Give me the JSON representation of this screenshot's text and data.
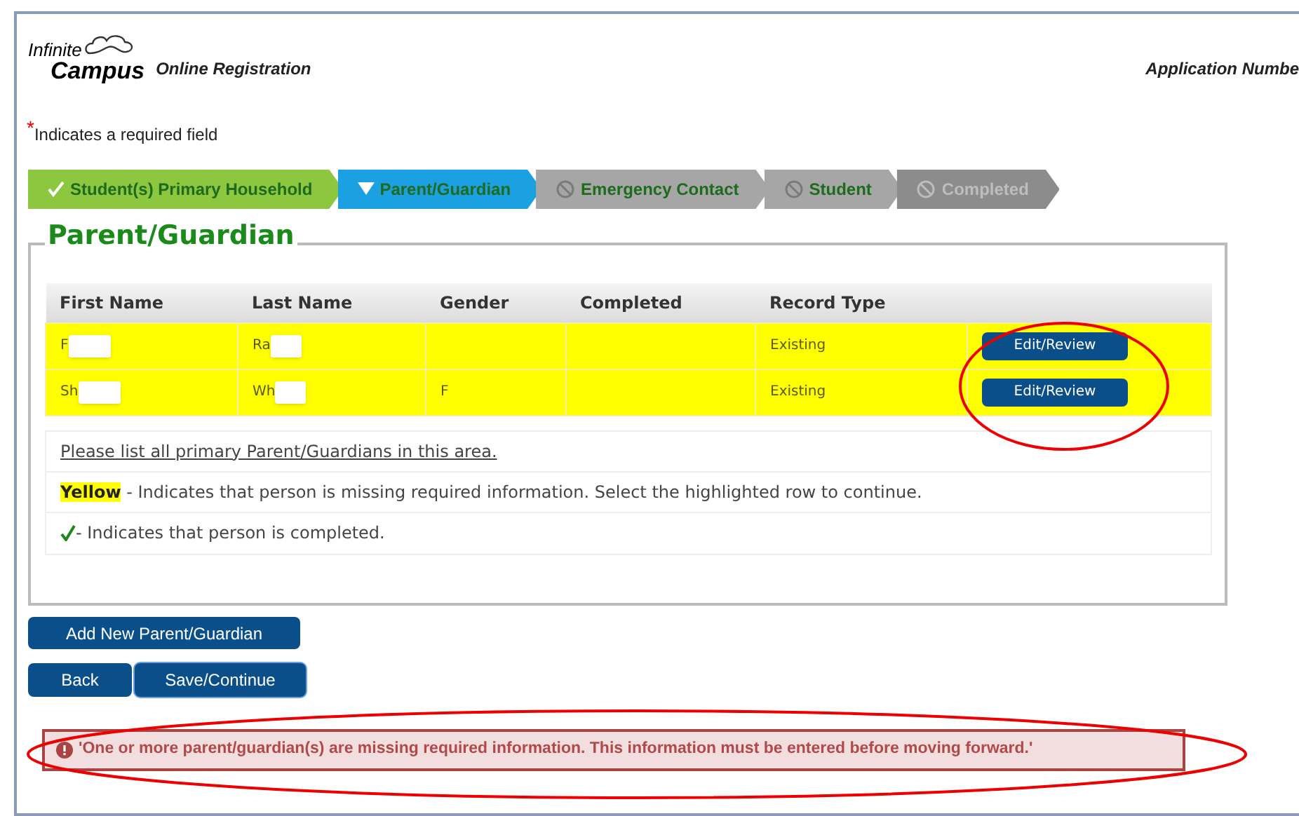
{
  "header": {
    "logo_top": "Infinite",
    "logo_bottom": "Campus",
    "app_name": "Online Registration",
    "application_number_label": "Application Numbe"
  },
  "required_note": {
    "mark": "*",
    "text": "Indicates a required field"
  },
  "steps": [
    {
      "label": "Student(s) Primary Household",
      "kind": "complete",
      "selected": false
    },
    {
      "label": "Parent/Guardian",
      "kind": "current",
      "selected": true
    },
    {
      "label": "Emergency Contact",
      "kind": "locked",
      "selected": false
    },
    {
      "label": "Student",
      "kind": "locked",
      "selected": false
    },
    {
      "label": "Completed",
      "kind": "unavailable",
      "selected": false
    }
  ],
  "section_title": "Parent/Guardian",
  "table": {
    "columns": [
      "First Name",
      "Last Name",
      "Gender",
      "Completed",
      "Record Type"
    ],
    "rows": [
      {
        "first_name": "F",
        "last_name": "Ra",
        "record_type": "Existing",
        "missing_info": true,
        "action": "Edit/Review"
      },
      {
        "first_name": "Sh",
        "last_name": "Wh",
        "gender": "F",
        "record_type": "Existing",
        "missing_info": true,
        "action": "Edit/Review"
      }
    ]
  },
  "notes": {
    "link": "Please list all primary Parent/Guardians in this area.",
    "yellow_label": "Yellow",
    "yellow_text": " - Indicates that person is missing required information. Select the highlighted row to continue.",
    "check_text": " - Indicates that person is completed."
  },
  "buttons": {
    "add": "Add New Parent/Guardian",
    "back": "Back",
    "save": "Save/Continue"
  },
  "error": "'One or more parent/guardian(s) are missing required information. This information must be entered before moving forward.'"
}
